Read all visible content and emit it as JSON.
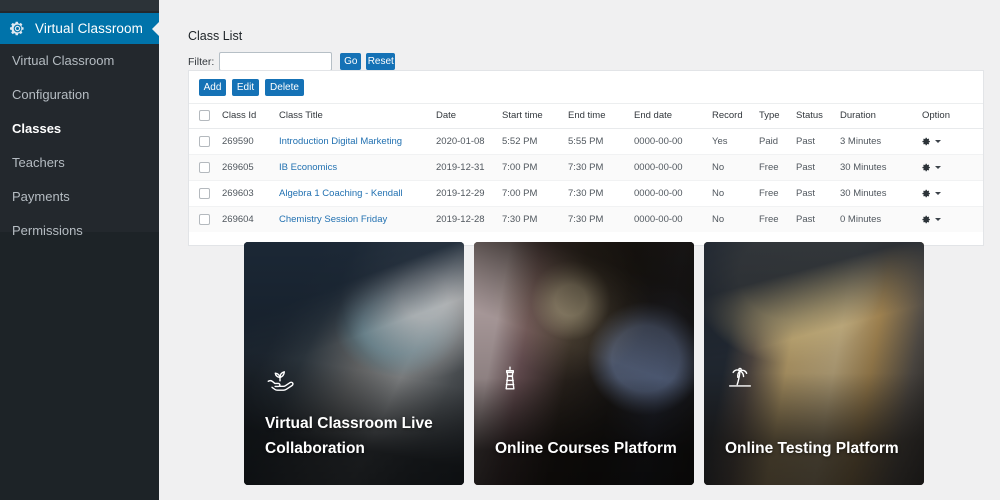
{
  "colors": {
    "brand_blue": "#0073aa",
    "button_blue": "#1572b6",
    "link_blue": "#2271b1",
    "sidebar_bg": "#23282d",
    "sidebar_bg_dark": "#1d2327",
    "page_bg": "#f0f0f1"
  },
  "sidebar": {
    "brand": {
      "icon": "gear-icon",
      "label": "Virtual Classroom"
    },
    "items": [
      {
        "label": "Virtual Classroom",
        "active": false
      },
      {
        "label": "Configuration",
        "active": false
      },
      {
        "label": "Classes",
        "active": true
      },
      {
        "label": "Teachers",
        "active": false
      },
      {
        "label": "Payments",
        "active": false
      },
      {
        "label": "Permissions",
        "active": false
      }
    ]
  },
  "main": {
    "page_title": "Class List",
    "filter": {
      "label": "Filter:",
      "value": "",
      "placeholder": "",
      "go_label": "Go",
      "reset_label": "Reset"
    },
    "actions": {
      "add_label": "Add",
      "edit_label": "Edit",
      "delete_label": "Delete"
    },
    "table": {
      "columns": [
        "",
        "Class Id",
        "Class Title",
        "Date",
        "Start time",
        "End time",
        "End date",
        "Record",
        "Type",
        "Status",
        "Duration",
        "Option"
      ],
      "rows": [
        {
          "class_id": "269590",
          "class_title": "Introduction Digital Marketing",
          "date": "2020-01-08",
          "start_time": "5:52 PM",
          "end_time": "5:55 PM",
          "end_date": "0000-00-00",
          "record": "Yes",
          "type": "Paid",
          "status": "Past",
          "duration": "3 Minutes",
          "option_icon": "gear-icon"
        },
        {
          "class_id": "269605",
          "class_title": "IB Economics",
          "date": "2019-12-31",
          "start_time": "7:00 PM",
          "end_time": "7:30 PM",
          "end_date": "0000-00-00",
          "record": "No",
          "type": "Free",
          "status": "Past",
          "duration": "30 Minutes",
          "option_icon": "gear-icon"
        },
        {
          "class_id": "269603",
          "class_title": "Algebra 1 Coaching - Kendall",
          "date": "2019-12-29",
          "start_time": "7:00 PM",
          "end_time": "7:30 PM",
          "end_date": "0000-00-00",
          "record": "No",
          "type": "Free",
          "status": "Past",
          "duration": "30 Minutes",
          "option_icon": "gear-icon"
        },
        {
          "class_id": "269604",
          "class_title": "Chemistry Session Friday",
          "date": "2019-12-28",
          "start_time": "7:30 PM",
          "end_time": "7:30 PM",
          "end_date": "0000-00-00",
          "record": "No",
          "type": "Free",
          "status": "Past",
          "duration": "0 Minutes",
          "option_icon": "gear-icon"
        }
      ]
    },
    "cards": [
      {
        "title": "Virtual Classroom Live Collaboration",
        "icon": "hand-sprout-icon",
        "photo_alt": "student with headphones writing beside a laptop"
      },
      {
        "title": "Online Courses Platform",
        "icon": "lighthouse-icon",
        "photo_alt": "woman watching a video lesson on a monitor under a desk lamp"
      },
      {
        "title": "Online Testing Platform",
        "icon": "palm-tree-icon",
        "photo_alt": "child raising a fist in front of a computer and colourful books"
      }
    ]
  }
}
